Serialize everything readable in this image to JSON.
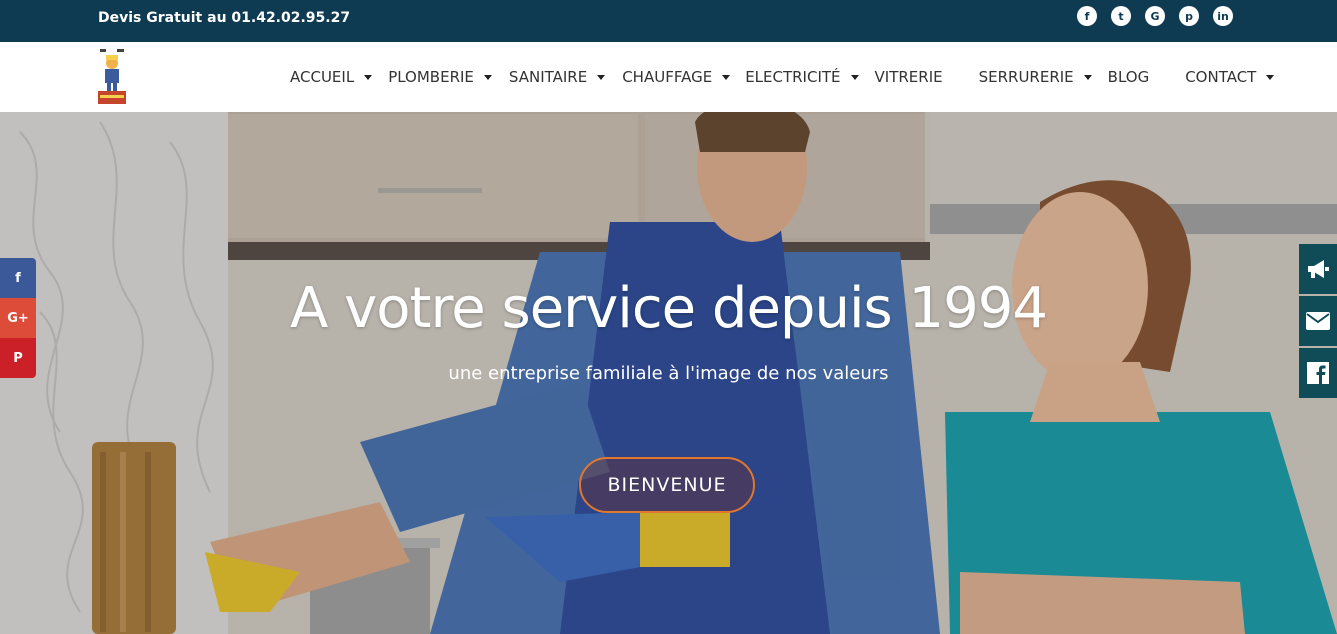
{
  "topbar": {
    "phone_text": "Devis Gratuit au 01.42.02.95.27",
    "social": [
      {
        "name": "facebook-icon",
        "glyph": "f"
      },
      {
        "name": "twitter-icon",
        "glyph": "t"
      },
      {
        "name": "google-plus-icon",
        "glyph": "G"
      },
      {
        "name": "pinterest-icon",
        "glyph": "p"
      },
      {
        "name": "linkedin-icon",
        "glyph": "in"
      }
    ]
  },
  "nav": {
    "items": [
      {
        "label": "ACCUEIL",
        "dropdown": true
      },
      {
        "label": "PLOMBERIE",
        "dropdown": true
      },
      {
        "label": "SANITAIRE",
        "dropdown": true
      },
      {
        "label": "CHAUFFAGE",
        "dropdown": true
      },
      {
        "label": "ELECTRICITÉ",
        "dropdown": true
      },
      {
        "label": "VITRERIE",
        "dropdown": false
      },
      {
        "label": "SERRURERIE",
        "dropdown": true
      },
      {
        "label": "BLOG",
        "dropdown": false
      },
      {
        "label": "CONTACT",
        "dropdown": true
      }
    ]
  },
  "hero": {
    "title": "A votre service depuis 1994",
    "subtitle": "une entreprise familiale à l'image de nos valeurs",
    "button_label": "BIENVENUE"
  },
  "share_left": {
    "facebook": "f",
    "googleplus": "G+",
    "pinterest": "P"
  },
  "side_right": [
    "megaphone-icon",
    "envelope-icon",
    "facebook-icon"
  ],
  "colors": {
    "topbar": "#0f3b52",
    "accent": "#e0772f",
    "side_widget": "#0f4c57"
  }
}
